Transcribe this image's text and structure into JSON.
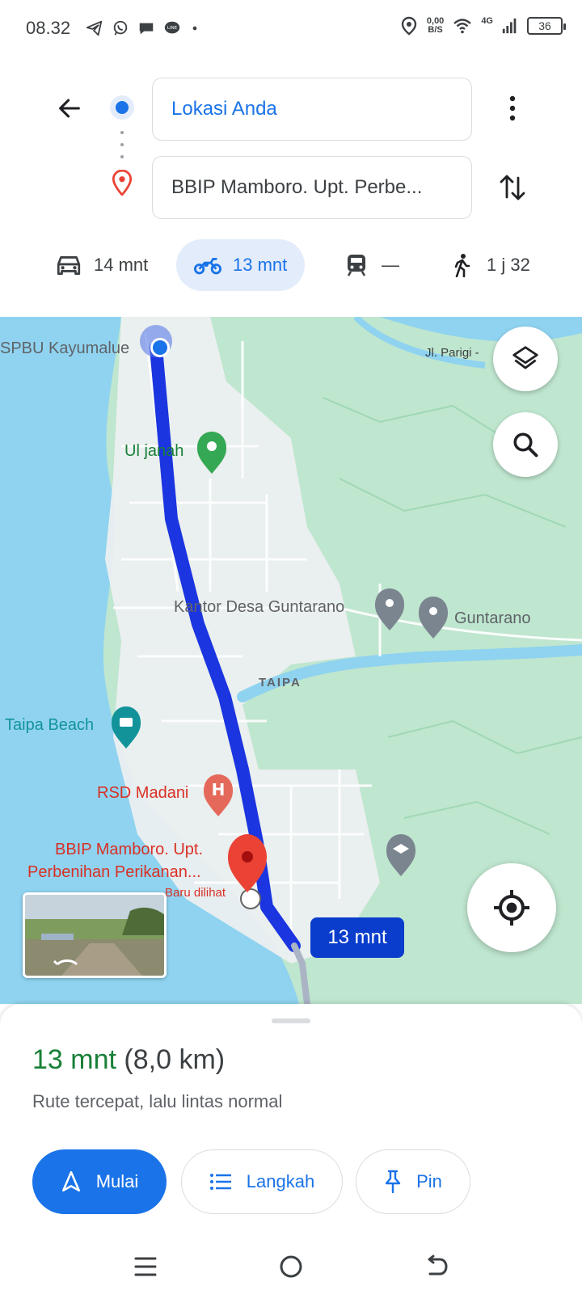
{
  "status_bar": {
    "time": "08.32",
    "net_speed_value": "0,00",
    "net_speed_unit": "B/S",
    "network_type": "4G",
    "battery": "36"
  },
  "directions": {
    "origin": "Lokasi Anda",
    "destination": "BBIP Mamboro. Upt. Perbe..."
  },
  "modes": [
    {
      "name": "car",
      "label": "14 mnt",
      "icon": "car-icon"
    },
    {
      "name": "motorcycle",
      "label": "13 mnt",
      "icon": "motorcycle-icon",
      "selected": true
    },
    {
      "name": "transit",
      "label": "—",
      "icon": "train-icon"
    },
    {
      "name": "walk",
      "label": "1 j 32",
      "icon": "walk-icon"
    }
  ],
  "map": {
    "labels": {
      "spbu": "SPBU Kayumalue",
      "road": "Jl. Parigi -",
      "uljanah": "Ul janah",
      "kantor": "Kantor Desa Guntarano",
      "guntarano": "Guntarano",
      "taipa": "TAIPA",
      "beach": "Taipa Beach",
      "rsd": "RSD Madani",
      "dest_line1": "BBIP Mamboro. Upt.",
      "dest_line2": "Perbenihan Perikanan...",
      "dest_line3": "Baru dilihat"
    },
    "eta_chip": "13 mnt",
    "route_color": "#1b35e0"
  },
  "sheet": {
    "time": "13 mnt",
    "distance": "(8,0 km)",
    "description": "Rute tercepat, lalu lintas normal",
    "buttons": {
      "start": "Mulai",
      "steps": "Langkah",
      "pin": "Pin"
    }
  },
  "colors": {
    "accent": "#1a73e8",
    "time_green": "#188038",
    "destination_red": "#ea4335"
  }
}
